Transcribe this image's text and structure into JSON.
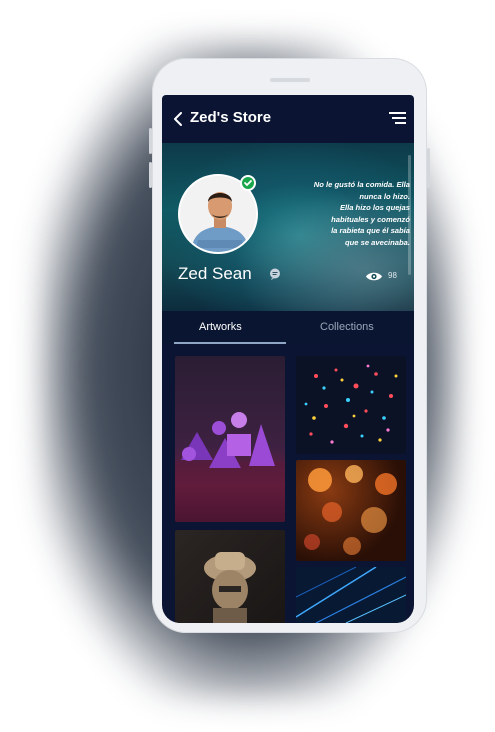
{
  "header": {
    "title": "Zed's Store",
    "back_icon": "chevron-left-icon",
    "menu_icon": "menu-lines-icon"
  },
  "profile": {
    "name": "Zed Sean",
    "bio_lines": [
      "No le gustó la comida. Ella",
      "nunca lo hizo.",
      "Ella hizo los quejas",
      "habituales y comenzó",
      "la rabieta que él sabía",
      "que se avecinaba."
    ],
    "views": "98",
    "verified_icon": "check-badge-icon",
    "chat_icon": "chat-bubble-icon",
    "views_icon": "eye-icon"
  },
  "tabs": [
    {
      "label": "Artworks",
      "active": true
    },
    {
      "label": "Collections",
      "active": false
    }
  ],
  "artworks": [
    {
      "subject": "purple geometric shapes"
    },
    {
      "subject": "colorful light particles"
    },
    {
      "subject": "orange bokeh lights"
    },
    {
      "subject": "statue with hat"
    },
    {
      "subject": "blue light lines"
    }
  ],
  "colors": {
    "screen_bg": "#0b1533",
    "accent": "#8fa6c5",
    "verified": "#1aa64a",
    "text": "#ffffff",
    "muted": "#9aa6b8"
  }
}
